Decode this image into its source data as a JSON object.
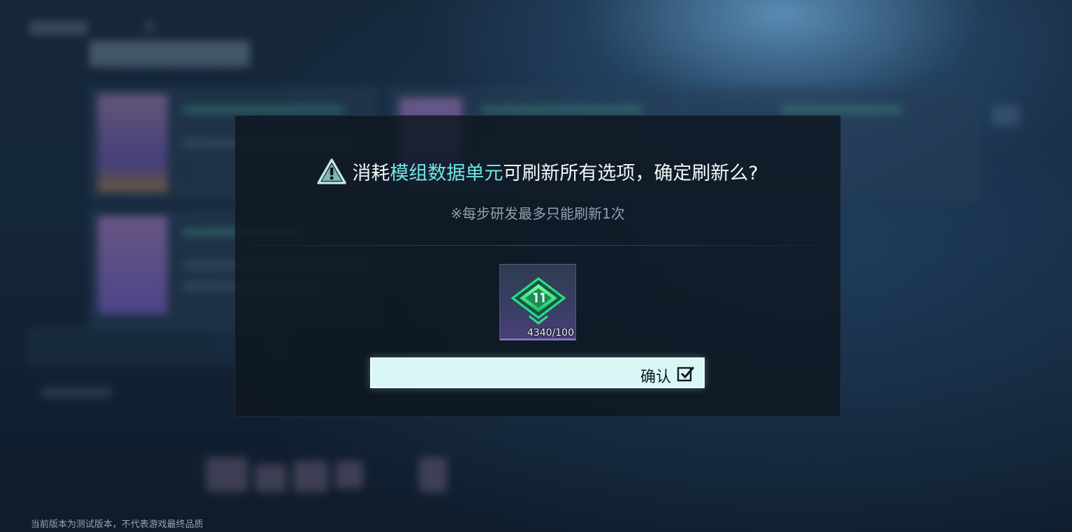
{
  "dialog": {
    "title_prefix": "消耗",
    "title_highlight": "模组数据单元",
    "title_suffix": "可刷新所有选项，确定刷新么?",
    "subtitle": "※每步研发最多只能刷新1次",
    "item": {
      "icon": "module-data-unit-icon",
      "count": "4340/100"
    },
    "confirm_label": "确认",
    "confirm_icon": "checkbox-check-icon"
  },
  "footer": {
    "note": "当前版本为测试版本，不代表游戏最终品质"
  },
  "colors": {
    "highlight": "#6ee6e2",
    "button_bg": "#d9f7f6",
    "overlay_bg": "#0e1620"
  }
}
